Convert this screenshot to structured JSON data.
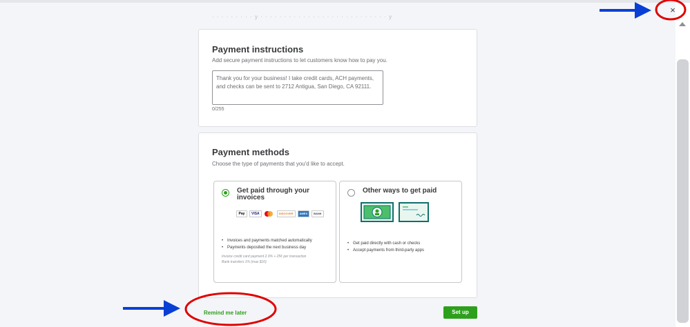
{
  "header": {
    "faded_text": "· · · · · · ·  · ·   y · · ·   · · · · ·   · ·  · · ·   · ·  · · · · ·   · ·  · · ·   · · y",
    "close_glyph": "×"
  },
  "payment_instructions": {
    "title": "Payment instructions",
    "subtitle": "Add secure payment instructions to let customers know how to pay you.",
    "text_value": "Thank you for your business! I take credit cards, ACH payments, and checks can be sent to 2712 Antigua, San Diego, CA 92111.",
    "counter": "0/255"
  },
  "payment_methods": {
    "title": "Payment methods",
    "subtitle": "Choose the type of payments that you'd like to accept.",
    "options": [
      {
        "title": "Get paid through your invoices",
        "selected": true,
        "brands": [
          "Pay",
          "VISA",
          "mastercard",
          "DISCOVER",
          "AMEX",
          "BANK"
        ],
        "bullets": [
          "Invoices and payments matched automatically",
          "Payments deposited the next business day"
        ],
        "fine_print": [
          "Invoice credit card payment 2.9% + 25¢ per transaction",
          "Bank transfers 1% (max $10)"
        ]
      },
      {
        "title": "Other ways to get paid",
        "selected": false,
        "illustrations": [
          "cash-icon",
          "check-icon"
        ],
        "bullets": [
          "Get paid directly with cash or checks",
          "Accept payments from third-party apps"
        ]
      }
    ]
  },
  "footer": {
    "remind_label": "Remind me later",
    "setup_label": "Set up"
  },
  "colors": {
    "accent_green": "#2ca01c",
    "annotation_red": "#e00000",
    "annotation_blue": "#0a3fd6"
  }
}
